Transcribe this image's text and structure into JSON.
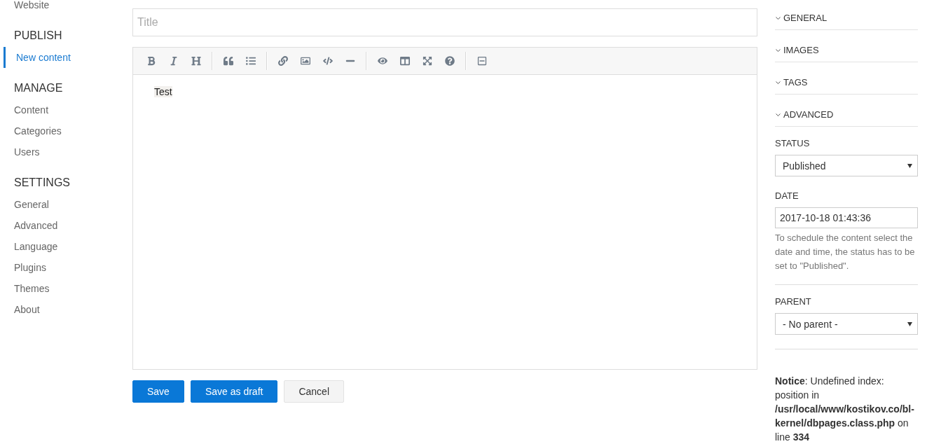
{
  "sidebar": {
    "sections": [
      {
        "items": [
          {
            "label": "Website",
            "selected": false
          }
        ]
      },
      {
        "title": "PUBLISH",
        "items": [
          {
            "label": "New content",
            "selected": true
          }
        ]
      },
      {
        "title": "MANAGE",
        "items": [
          {
            "label": "Content",
            "selected": false
          },
          {
            "label": "Categories",
            "selected": false
          },
          {
            "label": "Users",
            "selected": false
          }
        ]
      },
      {
        "title": "SETTINGS",
        "items": [
          {
            "label": "General",
            "selected": false
          },
          {
            "label": "Advanced",
            "selected": false
          },
          {
            "label": "Language",
            "selected": false
          },
          {
            "label": "Plugins",
            "selected": false
          },
          {
            "label": "Themes",
            "selected": false
          },
          {
            "label": "About",
            "selected": false
          }
        ]
      }
    ]
  },
  "editor": {
    "title_placeholder": "Title",
    "content": "Test"
  },
  "actions": [
    {
      "label": "Save",
      "kind": "primary"
    },
    {
      "label": "Save as draft",
      "kind": "primary"
    },
    {
      "label": "Cancel",
      "kind": "secondary"
    }
  ],
  "settings_panel": {
    "sections": [
      {
        "label": "GENERAL"
      },
      {
        "label": "IMAGES"
      },
      {
        "label": "TAGS"
      },
      {
        "label": "ADVANCED"
      }
    ],
    "status": {
      "label": "STATUS",
      "value": "Published"
    },
    "date": {
      "label": "DATE",
      "value": "2017-10-18 01:43:36",
      "help": "To schedule the content select the date and time, the status has to be set to \"Published\"."
    },
    "parent": {
      "label": "PARENT",
      "value": "- No parent -"
    }
  },
  "notice": "**Notice**: Undefined index: position in **/usr/local/www/kostikov.co/bl-kernel/dbpages.class.php** on line **334**"
}
